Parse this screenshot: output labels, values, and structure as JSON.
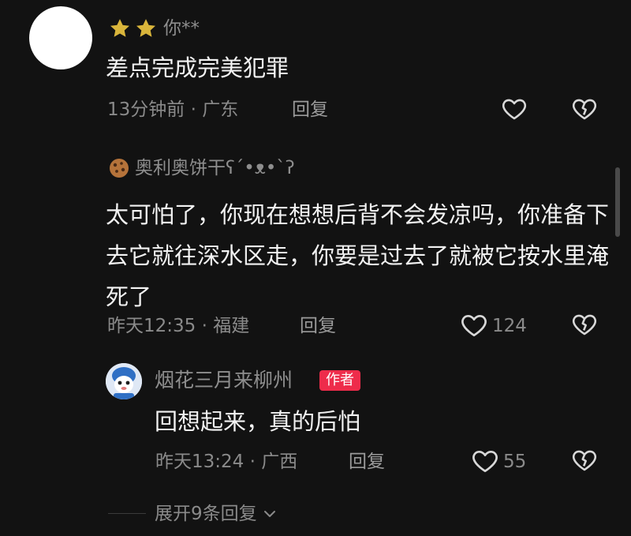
{
  "comment1": {
    "rating_stars": 2,
    "username": "你**",
    "text": "差点完成完美犯罪",
    "time_location": "13分钟前 · 广东",
    "reply_label": "回复"
  },
  "comment2": {
    "username": "奥利奥饼干ʕ´•ᴥ•`ʔ",
    "text": "太可怕了，你现在想想后背不会发凉吗，你准备下去它就往深水区走，你要是过去了就被它按水里淹死了",
    "time_location": "昨天12:35 · 福建",
    "reply_label": "回复",
    "like_count": "124"
  },
  "reply1": {
    "username": "烟花三月来柳州",
    "badge": "作者",
    "text": "回想起来，真的后怕",
    "time_location": "昨天13:24 · 广西",
    "reply_label": "回复",
    "like_count": "55"
  },
  "expand": {
    "label": "展开9条回复"
  },
  "colors": {
    "background": "#121212",
    "star": "#d9b53b",
    "author_badge": "#ee2c4b"
  },
  "icons": [
    "star-icon",
    "heart-icon",
    "broken-heart-icon",
    "cookie-icon",
    "chevron-down-icon"
  ]
}
